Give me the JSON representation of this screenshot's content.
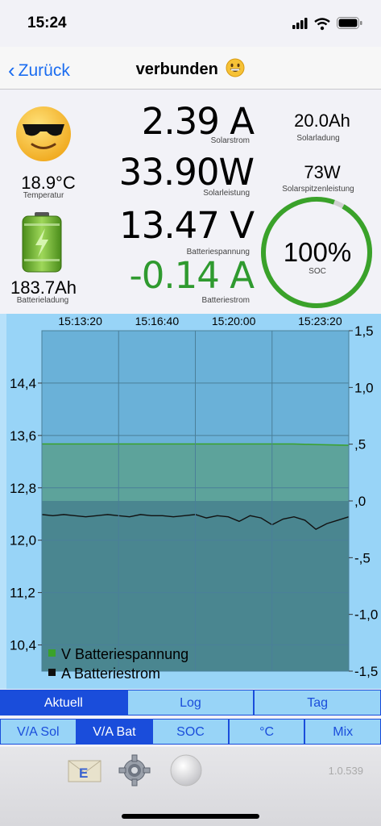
{
  "status_bar": {
    "time": "15:24"
  },
  "nav": {
    "back_label": "Zurück",
    "title": "verbunden"
  },
  "metrics": {
    "temperature": {
      "value": "18.9°C",
      "label": "Temperatur"
    },
    "battery_charge": {
      "value": "183.7Ah",
      "label": "Batterieladung"
    },
    "solar_current": {
      "value": "2.39 A",
      "label": "Solarstrom"
    },
    "solar_power": {
      "value": "33.90W",
      "label": "Solarleistung"
    },
    "battery_voltage": {
      "value": "13.47 V",
      "label": "Batteriespannung"
    },
    "battery_current": {
      "value": "-0.14 A",
      "label": "Batteriestrom",
      "color": "#2f9a2f"
    },
    "solar_charge": {
      "value": "20.0Ah",
      "label": "Solarladung"
    },
    "solar_peak_power": {
      "value": "73W",
      "label": "Solarspitzenleistung"
    },
    "soc": {
      "value": "100%",
      "label": "SOC",
      "fraction": 1.0,
      "color": "#3aa22a"
    }
  },
  "chart_data": {
    "type": "area",
    "x_tick_labels": [
      "15:13:20",
      "15:16:40",
      "15:20:00",
      "15:23:20"
    ],
    "left_axis": {
      "ticks": [
        "14,4",
        "13,6",
        "12,8",
        "12,0",
        "11,2",
        "10,4"
      ],
      "ylim": [
        10.0,
        15.2
      ]
    },
    "right_axis": {
      "ticks": [
        "1,5",
        "1,0",
        ",5",
        ",0",
        "-,5",
        "-1,0",
        "-1,5"
      ],
      "ylim": [
        -1.5,
        1.5
      ]
    },
    "series": [
      {
        "name": "V Batteriespannung",
        "axis": "left",
        "color": "#3aa22a",
        "values": [
          13.47,
          13.47,
          13.47,
          13.47,
          13.47,
          13.47,
          13.47,
          13.47,
          13.47,
          13.47,
          13.46,
          13.45
        ]
      },
      {
        "name": "A Batteriestrom",
        "axis": "right",
        "color": "#111111",
        "values": [
          -0.12,
          -0.13,
          -0.12,
          -0.13,
          -0.14,
          -0.13,
          -0.12,
          -0.13,
          -0.14,
          -0.12,
          -0.13,
          -0.13,
          -0.14,
          -0.13,
          -0.12,
          -0.15,
          -0.13,
          -0.14,
          -0.18,
          -0.13,
          -0.15,
          -0.21,
          -0.16,
          -0.14,
          -0.17,
          -0.25,
          -0.2,
          -0.17,
          -0.14
        ]
      }
    ],
    "legend_placement": "bottom-left",
    "grid": true
  },
  "tabs_row1": [
    "Aktuell",
    "Log",
    "Tag"
  ],
  "tabs_row2": [
    "V/A Sol",
    "V/A Bat",
    "SOC",
    "°C",
    "Mix"
  ],
  "toolbar": {
    "version": "1.0.539"
  }
}
